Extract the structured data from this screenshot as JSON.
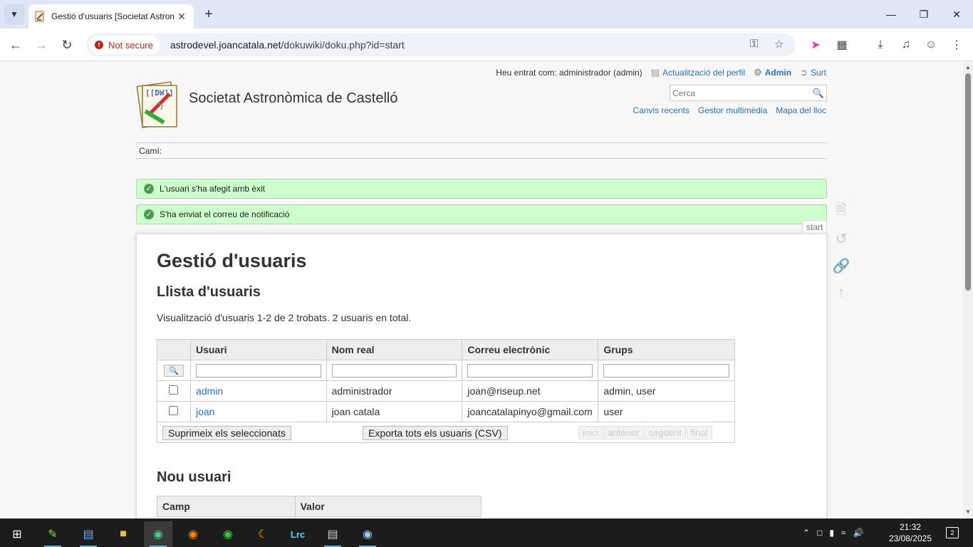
{
  "browser": {
    "tab_title": "Gestió d'usuaris [Societat Astron",
    "url_host": "astrodevel.joancatala.net",
    "url_path": "/dokuwiki/doku.php?id=start",
    "security_label": "Not secure"
  },
  "userbar": {
    "logged_in": "Heu entrat com: administrador (admin)",
    "profile": "Actualització del perfil",
    "admin": "Admin",
    "logout": "Surt"
  },
  "site": {
    "title": "Societat Astronòmica de Castelló",
    "search_placeholder": "Cerca",
    "tools": [
      "Canvis recents",
      "Gestor multimèdia",
      "Mapa del lloc"
    ],
    "breadcrumb": "Camí:"
  },
  "messages": [
    "L'usuari s'ha afegit amb èxit",
    "S'ha enviat el correu de notificació"
  ],
  "page_id": "start",
  "content": {
    "title": "Gestió d'usuaris",
    "list_heading": "Llista d'usuaris",
    "info": "Visualització d'usuaris 1-2 de 2 trobats. 2 usuaris en total.",
    "columns": [
      "Usuari",
      "Nom real",
      "Correu electrònic",
      "Grups"
    ],
    "rows": [
      {
        "user": "admin",
        "name": "administrador",
        "email": "joan@riseup.net",
        "groups": "admin, user"
      },
      {
        "user": "joan",
        "name": "joan catala",
        "email": "joancatalapinyo@gmail.com",
        "groups": "user"
      }
    ],
    "delete_selected": "Suprimeix els seleccionats",
    "export_all": "Exporta tots els usuaris (CSV)",
    "pager": [
      "inici",
      "anterior",
      "següent",
      "final"
    ],
    "new_user_heading": "Nou usuari",
    "new_user_columns": [
      "Camp",
      "Valor"
    ]
  },
  "taskbar": {
    "time": "21:32",
    "date": "23/08/2025",
    "notifications": "2"
  }
}
